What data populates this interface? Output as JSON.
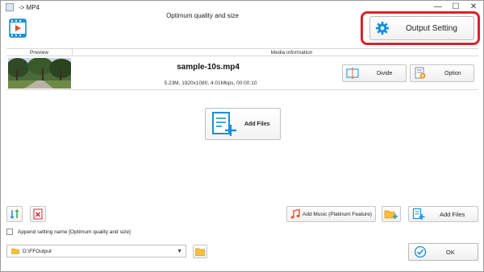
{
  "window": {
    "title": "-> MP4",
    "controls": {
      "minimize": "—",
      "maximize": "☐",
      "close": "✕"
    }
  },
  "header": {
    "profile_title": "Optimum quality and size",
    "output_setting_label": "Output Setting"
  },
  "file_list": {
    "columns": [
      "Preview",
      "Media information"
    ],
    "items": [
      {
        "name": "sample-10s.mp4",
        "info": "5.23M, 1920x1080, 4.01Mbps, 00:00:10",
        "divide_label": "Divide",
        "option_label": "Option"
      }
    ]
  },
  "center": {
    "add_files_label": "Add Files"
  },
  "bottom": {
    "add_music_label": "Add Music (Platinum Feature)",
    "add_files_label": "Add Files",
    "append_setting_label": "Append setting name [Optimum quality and size]",
    "append_checked": false,
    "output_path": "D:\\FFOutput",
    "ok_label": "OK"
  },
  "colors": {
    "highlight": "#d9232c",
    "accent_blue": "#1a8fd6",
    "red_icon": "#d9232c"
  }
}
